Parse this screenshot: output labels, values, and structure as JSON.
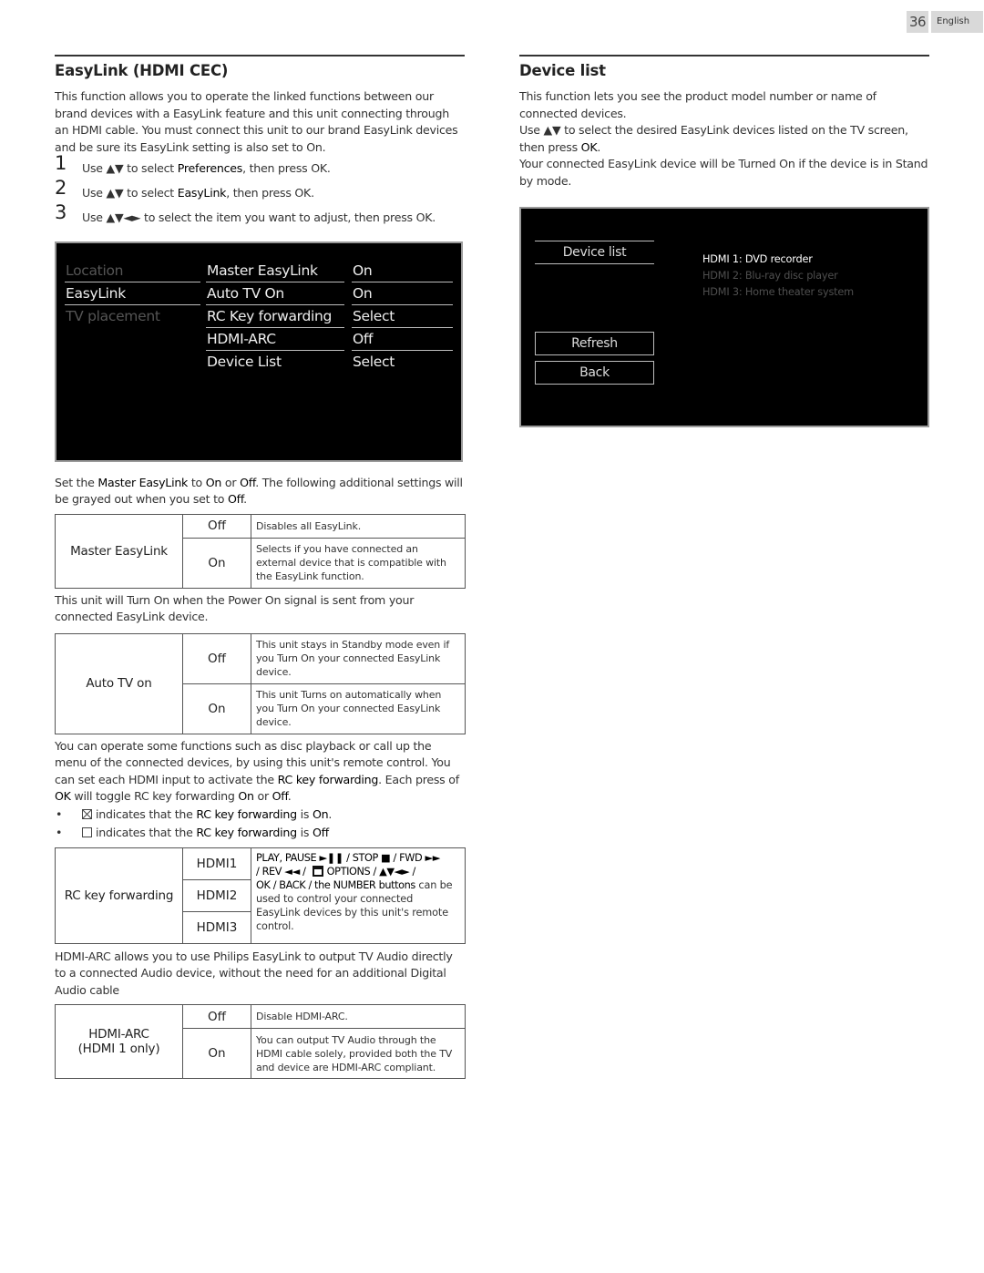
{
  "page": {
    "number": "36",
    "language": "English"
  },
  "left": {
    "title": "EasyLink (HDMI CEC)",
    "intro": "This function allows you to operate the linked functions between our brand devices with a EasyLink feature and this unit connecting through an HDMI cable. You must connect this unit to our brand EasyLink devices and be sure its EasyLink setting is also set to On.",
    "steps": [
      {
        "num": "1",
        "pre": "Use ▲▼ to select ",
        "em": "Preferences",
        "post": ", then press OK."
      },
      {
        "num": "2",
        "pre": "Use ▲▼ to select ",
        "em": "EasyLink",
        "post": ", then press OK."
      },
      {
        "num": "3",
        "pre": "Use ▲▼◄► to select the item you want to adjust, then press OK.",
        "em": "",
        "post": ""
      }
    ],
    "menu": {
      "categories": [
        {
          "label": "Location",
          "state": "dim"
        },
        {
          "label": "EasyLink",
          "state": "active"
        },
        {
          "label": "TV placement",
          "state": "dim"
        }
      ],
      "items": [
        {
          "label": "Master EasyLink",
          "value": "On"
        },
        {
          "label": "Auto TV On",
          "value": "On"
        },
        {
          "label": "RC Key forwarding",
          "value": "Select"
        },
        {
          "label": "HDMI-ARC",
          "value": "Off"
        },
        {
          "label": "Device List",
          "value": "Select"
        }
      ]
    },
    "master_para": {
      "t1": "Set the ",
      "e1": "Master EasyLink",
      "t2": " to ",
      "e2": "On",
      "t3": " or ",
      "e3": "Off",
      "t4": ". The following additional settings will be grayed out when you set to ",
      "e4": "Off",
      "t5": "."
    },
    "master_table": {
      "key": "Master EasyLink",
      "rows": [
        {
          "option": "Off",
          "desc": "Disables all EasyLink."
        },
        {
          "option": "On",
          "desc": "Selects if you have connected an external device that is compatible with the EasyLink function."
        }
      ]
    },
    "autotv_para": "This unit will Turn On when the Power On signal is sent from your connected EasyLink device.",
    "autotv_table": {
      "key": "Auto TV on",
      "rows": [
        {
          "option": "Off",
          "desc": "This unit stays in Standby mode even if you Turn On your connected EasyLink device."
        },
        {
          "option": "On",
          "desc": "This unit Turns on automatically when you Turn On your connected EasyLink device."
        }
      ]
    },
    "rc_para": {
      "t1": "You can operate some functions such as disc playback or call up the menu of the connected devices, by using this unit's remote control. You can set each HDMI input to activate the ",
      "e1": "RC key forwarding",
      "t2": ". Each press of ",
      "e2": "OK",
      "t3": " will toggle RC key forwarding ",
      "e3": "On",
      "t4": " or ",
      "e4": "Off",
      "t5": "."
    },
    "bullets": [
      {
        "icon": "checked-box-icon",
        "t1": "indicates that the ",
        "e1": "RC key forwarding",
        "t2": " is ",
        "e2": "On",
        "t3": "."
      },
      {
        "icon": "empty-box-icon",
        "t1": "indicates that the ",
        "e1": "RC key forwarding",
        "t2": " is ",
        "e2": "Off",
        "t3": ""
      }
    ],
    "rc_table": {
      "key": "RC key forwarding",
      "inputs": [
        "HDMI1",
        "HDMI2",
        "HDMI3"
      ],
      "desc": {
        "line1": "PLAY, PAUSE ►❚❚ / STOP ■ / FWD ►►",
        "line2a": "/ REV ◄◄ / ",
        "line2b": "OPTIONS / ▲▼◄► /",
        "line3": "OK / BACK / the NUMBER buttons",
        "rest": " can be used to control your connected EasyLink devices by this unit's remote control."
      }
    },
    "arc_para": "HDMI-ARC allows you to use Philips EasyLink to output TV Audio directly to a connected Audio device, without the need for an additional Digital Audio cable",
    "arc_table": {
      "key_line1": "HDMI-ARC",
      "key_line2": "(HDMI 1 only)",
      "rows": [
        {
          "option": "Off",
          "desc": "Disable HDMI-ARC."
        },
        {
          "option": "On",
          "desc": "You can output TV Audio through the HDMI cable solely, provided both the TV and device are HDMI-ARC compliant."
        }
      ]
    }
  },
  "right": {
    "title": "Device list",
    "para1": "This function lets you see the product model number or name of connected devices.",
    "para2": {
      "t1": "Use ▲▼ to select the desired EasyLink devices listed on the TV screen, then press ",
      "e1": "OK",
      "t2": "."
    },
    "para3": "Your connected EasyLink device will be Turned On if the device is in Stand by mode.",
    "screen": {
      "header": "Device list",
      "refresh_label": "Refresh",
      "back_label": "Back",
      "devices": [
        {
          "label": "HDMI 1: DVD recorder",
          "selected": true
        },
        {
          "label": "HDMI 2: Blu-ray disc player",
          "selected": false
        },
        {
          "label": "HDMI 3: Home theater system",
          "selected": false
        }
      ]
    }
  },
  "colors": {
    "screen_bg": "#000000",
    "screen_border": "#9a9a9a",
    "tab_bg": "#d9d9d9",
    "dim_text": "#555555"
  }
}
